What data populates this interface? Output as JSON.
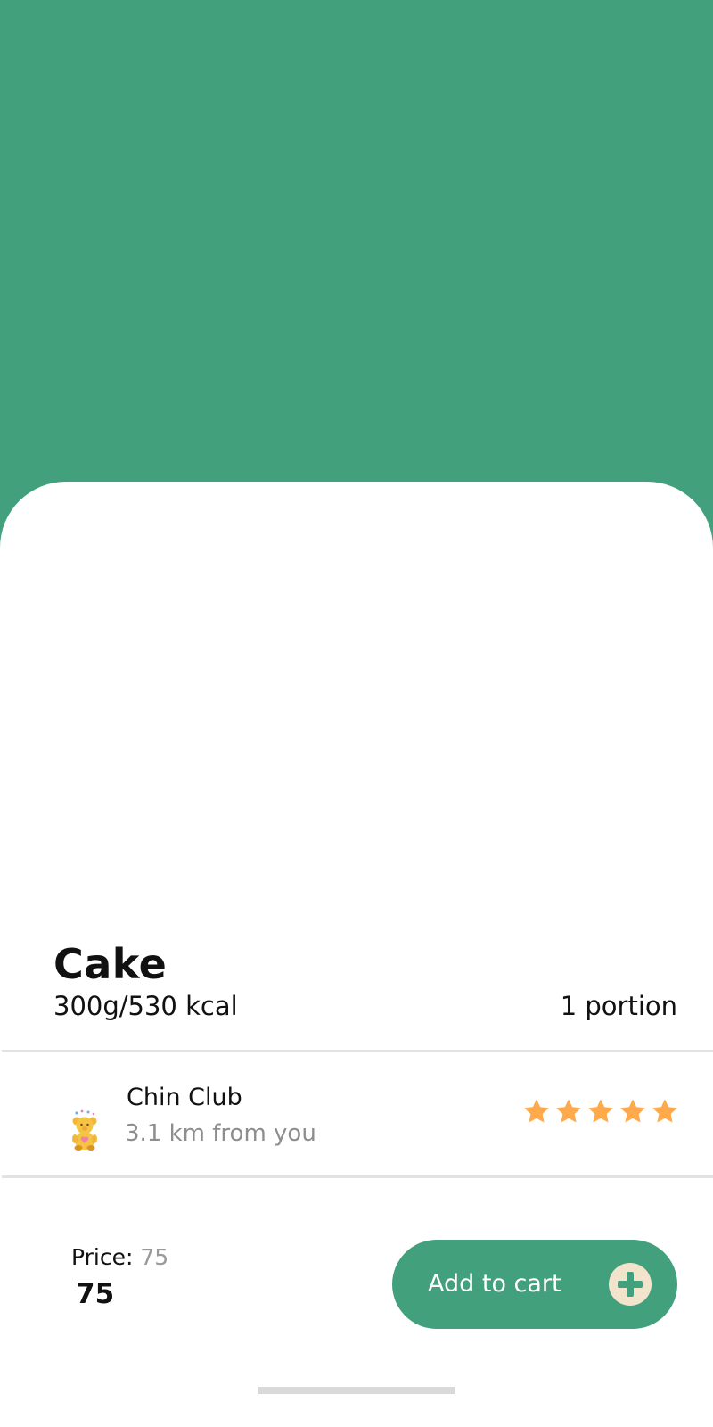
{
  "product": {
    "name": "Cake",
    "weight": "300g/",
    "calories": "530 kcal",
    "portion": "1 portion"
  },
  "store": {
    "icon": "teddy-bear-icon",
    "name": "Chin Club",
    "distance": "3.1 km from you",
    "rating": 5,
    "rating_max": 5
  },
  "pricing": {
    "label": "Price:",
    "old_price": "75",
    "price": "75"
  },
  "cart_button": {
    "label": "Add to cart",
    "icon": "plus-circle-icon"
  },
  "colors": {
    "accent": "#42A07C",
    "star": "#FFA94D",
    "plus_circle": "#F2E3CC"
  }
}
